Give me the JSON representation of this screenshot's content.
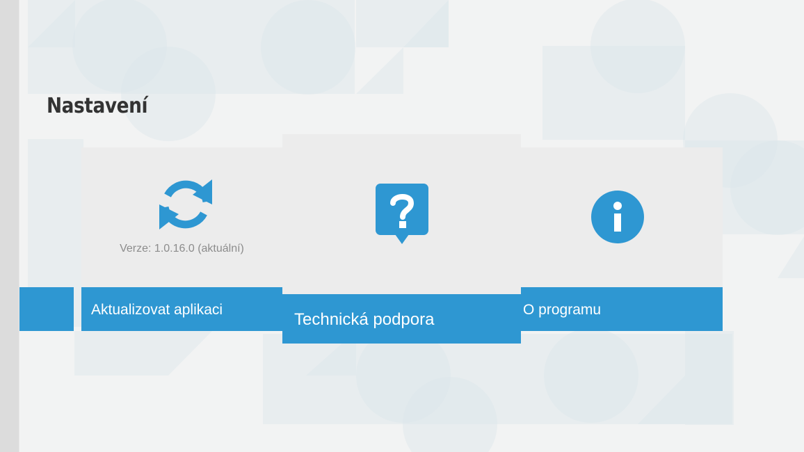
{
  "page": {
    "title": "Nastavení"
  },
  "tiles": [
    {
      "id": "update",
      "label": "Aktualizovat aplikaci",
      "subtext": "Verze: 1.0.16.0 (aktuální)",
      "icon": "refresh-icon"
    },
    {
      "id": "support",
      "label": "Technická podpora",
      "icon": "help-bubble-icon"
    },
    {
      "id": "about",
      "label": "O programu",
      "icon": "info-icon"
    }
  ],
  "colors": {
    "accent": "#2e97d2",
    "tile_background": "#ececec",
    "page_background": "#f2f3f3",
    "title_text": "#333333",
    "subtext": "#8c8c8c"
  }
}
